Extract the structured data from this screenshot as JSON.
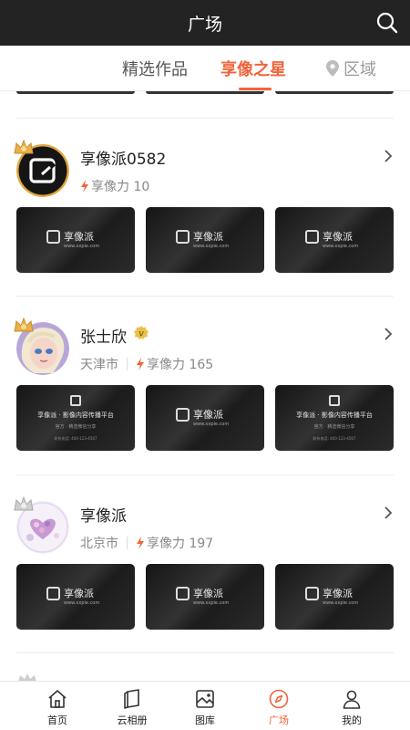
{
  "header": {
    "title": "广场"
  },
  "tabs": [
    {
      "label": "精选作品"
    },
    {
      "label": "享像之星"
    },
    {
      "label": "区域"
    }
  ],
  "users": [
    {
      "name": "享像派0582",
      "location": "",
      "power_label": "享像力 10",
      "verified": false
    },
    {
      "name": "张士欣",
      "location": "天津市",
      "power_label": "享像力 165",
      "verified": true
    },
    {
      "name": "享像派",
      "location": "北京市",
      "power_label": "享像力 197",
      "verified": false
    }
  ],
  "thumb_logo": {
    "brand": "享像派",
    "url": "www.xxpie.com"
  },
  "poster": {
    "title": "享像派 · 影像内容传播平台",
    "subtitle": "官方 · 精选微信分享",
    "footer": "联系电话: 400-123-4567"
  },
  "nav": [
    {
      "label": "首页",
      "icon": "home-icon"
    },
    {
      "label": "云相册",
      "icon": "album-icon"
    },
    {
      "label": "图库",
      "icon": "gallery-icon"
    },
    {
      "label": "广场",
      "icon": "compass-icon"
    },
    {
      "label": "我的",
      "icon": "profile-icon"
    }
  ],
  "colors": {
    "accent": "#f0643c",
    "header_bg": "#232323",
    "gold": "#e8b04a"
  }
}
